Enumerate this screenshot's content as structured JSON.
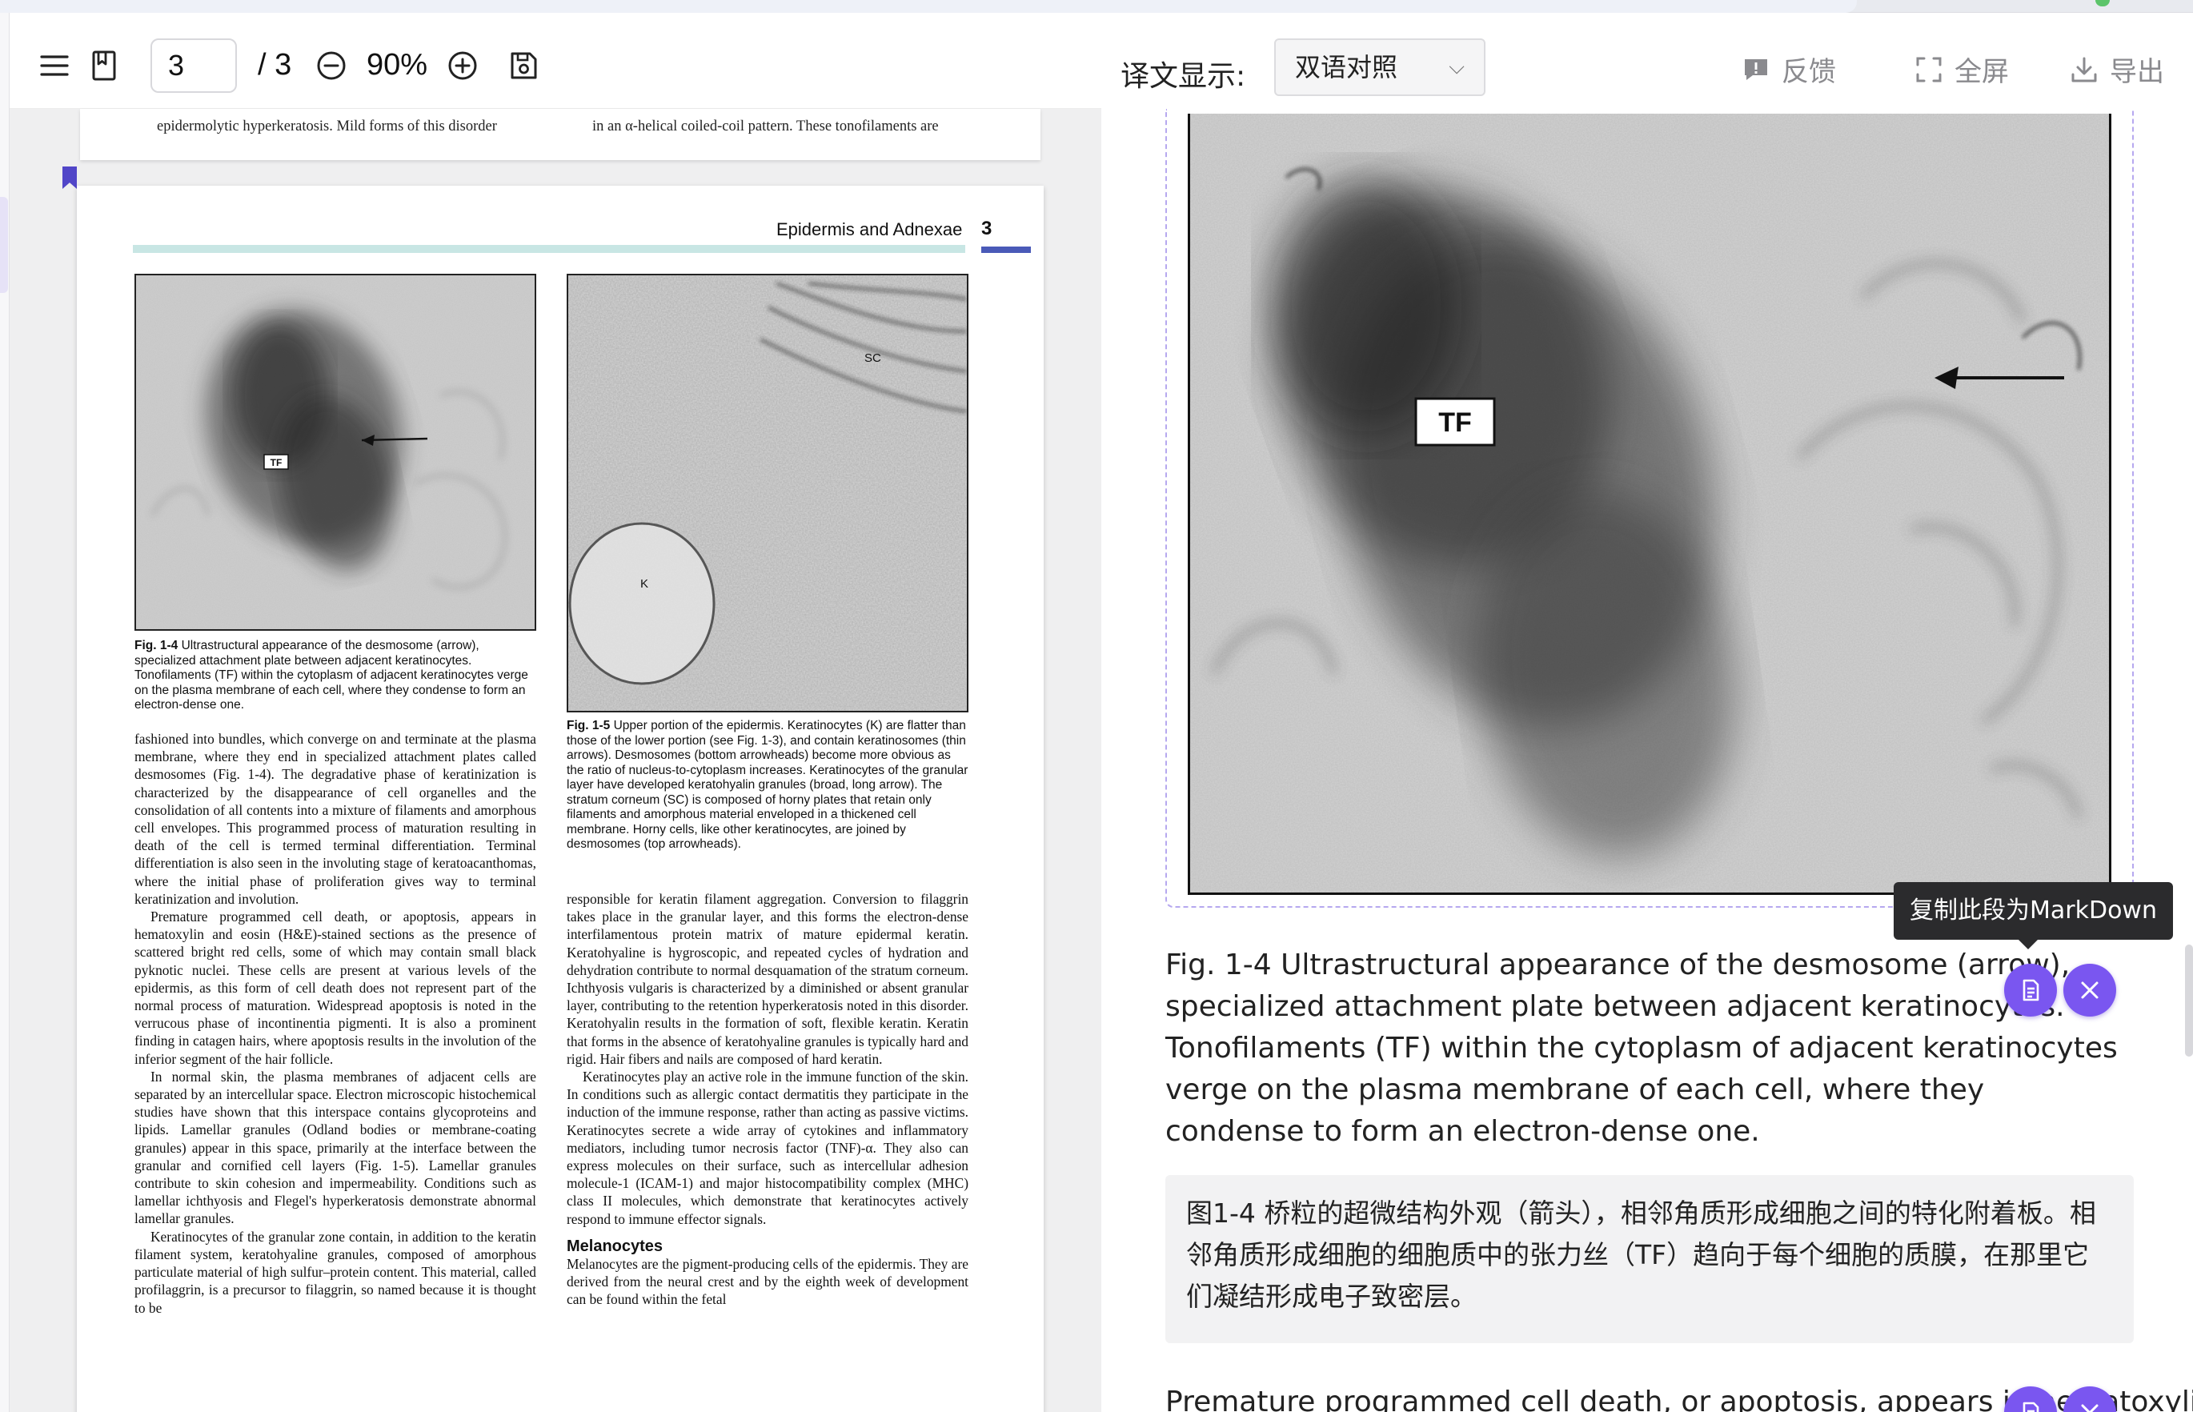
{
  "toolbar": {
    "page_current": "3",
    "page_total": "/ 3",
    "zoom": "90%"
  },
  "pdf": {
    "prev_page_line_left": "epidermolytic hyperkeratosis. Mild forms of this disorder",
    "prev_page_line_right": "in an α-helical coiled-coil pattern. These tonofilaments are",
    "running_head": "Epidermis and Adnexae",
    "page_number": "3",
    "fig1_label": "TF",
    "fig1_caption_label": "Fig. 1-4",
    "fig1_caption": "Ultrastructural appearance of the desmosome (arrow), specialized attachment plate between adjacent keratinocytes. Tonofilaments (TF) within the cytoplasm of adjacent keratinocytes verge on the plasma membrane of each cell, where they condense to form an electron-dense one.",
    "fig2_label_sc": "SC",
    "fig2_label_k": "K",
    "fig2_caption_label": "Fig. 1-5",
    "fig2_caption": "Upper portion of the epidermis. Keratinocytes (K) are flatter than those of the lower portion (see Fig. 1-3), and contain keratinosomes (thin arrows). Desmosomes (bottom arrowheads) become more obvious as the ratio of nucleus-to-cytoplasm increases. Keratinocytes of the granular layer have developed keratohyalin granules (broad, long arrow). The stratum corneum (SC) is composed of horny plates that retain only filaments and amorphous material enveloped in a thickened cell membrane. Horny cells, like other keratinocytes, are joined by desmosomes (top arrowheads).",
    "colA": [
      "fashioned into bundles, which converge on and terminate at the plasma membrane, where they end in specialized attachment plates called desmosomes (Fig. 1-4). The degradative phase of keratinization is characterized by the disappearance of cell organelles and the consolidation of all contents into a mixture of filaments and amorphous cell envelopes. This programmed process of maturation resulting in death of the cell is termed terminal differentiation. Terminal differentiation is also seen in the involuting stage of keratoacanthomas, where the initial phase of proliferation gives way to terminal keratinization and involution.",
      "Premature programmed cell death, or apoptosis, appears in hematoxylin and eosin (H&E)-stained sections as the presence of scattered bright red cells, some of which may contain small black pyknotic nuclei. These cells are present at various levels of the epidermis, as this form of cell death does not represent part of the normal process of maturation. Widespread apoptosis is noted in the verrucous phase of incontinentia pigmenti. It is also a prominent finding in catagen hairs, where apoptosis results in the involution of the inferior segment of the hair follicle.",
      "In normal skin, the plasma membranes of adjacent cells are separated by an intercellular space. Electron microscopic histochemical studies have shown that this interspace contains glycoproteins and lipids. Lamellar granules (Odland bodies or membrane-coating granules) appear in this space, primarily at the interface between the granular and cornified cell layers (Fig. 1-5). Lamellar granules contribute to skin cohesion and impermeability. Conditions such as lamellar ichthyosis and Flegel's hyperkeratosis demonstrate abnormal lamellar granules.",
      "Keratinocytes of the granular zone contain, in addition to the keratin filament system, keratohyaline granules, composed of amorphous particulate material of high sulfur–protein content. This material, called profilaggrin, is a precursor to filaggrin, so named because it is thought to be"
    ],
    "colB": [
      "responsible for keratin filament aggregation. Conversion to filaggrin takes place in the granular layer, and this forms the electron-dense interfilamentous protein matrix of mature epidermal keratin. Keratohyaline is hygroscopic, and repeated cycles of hydration and dehydration contribute to normal desquamation of the stratum corneum. Ichthyosis vulgaris is characterized by a diminished or absent granular layer, contributing to the retention hyperkeratosis noted in this disorder. Keratohyalin results in the formation of soft, flexible keratin. Keratin that forms in the absence of keratohyaline granules is typically hard and rigid. Hair fibers and nails are composed of hard keratin.",
      "Keratinocytes play an active role in the immune function of the skin. In conditions such as allergic contact dermatitis they participate in the induction of the immune response, rather than acting as passive victims. Keratinocytes secrete a wide array of cytokines and inflammatory mediators, including tumor necrosis factor (TNF)-α. They also can express molecules on their surface, such as intercellular adhesion molecule-1 (ICAM-1) and major histocompatibility complex (MHC) class II molecules, which demonstrate that keratinocytes actively respond to immune effector signals."
    ],
    "colB_heading": "Melanocytes",
    "colB_after": "Melanocytes are the pigment-producing cells of the epidermis. They are derived from the neural crest and by the eighth week of development can be found within the fetal"
  },
  "translation": {
    "display_label": "译文显示:",
    "mode_selected": "双语对照",
    "feedback_label": "反馈",
    "fullscreen_label": "全屏",
    "export_label": "导出",
    "figure_label": "TF",
    "tooltip": "复制此段为MarkDown",
    "en_paragraph": "Fig. 1-4 Ultrastructural appearance of the desmosome (arrow), specialized attachment plate between adjacent keratinocytes. Tonofilaments (TF) within the cytoplasm of adjacent keratinocytes verge on the plasma membrane of each cell, where they condense to form an electron-dense one.",
    "zh_paragraph": "图1-4 桥粒的超微结构外观（箭头），相邻角质形成细胞之间的特化附着板。相邻角质形成细胞的细胞质中的张力丝（TF）趋向于每个细胞的质膜，在那里它们凝结形成电子致密层。",
    "en_next": "Premature programmed cell death, or apoptosis, appears in hematoxylin"
  },
  "colors": {
    "accent": "#7a56f0",
    "bookmark": "#5146c8",
    "head_bar": "#c8e6e4",
    "frame_dashed": "#b6a8ef"
  }
}
